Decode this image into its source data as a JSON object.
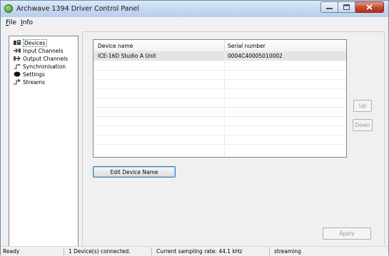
{
  "window": {
    "title": "Archwave 1394 Driver Control Panel"
  },
  "menu": [
    {
      "label": "File",
      "accel": "F",
      "rest": "ile"
    },
    {
      "label": "Info",
      "accel": "I",
      "rest": "nfo"
    }
  ],
  "tree": [
    {
      "label": "Devices",
      "icon": "devices-icon",
      "selected": true
    },
    {
      "label": "Input Channels",
      "icon": "input-channels-icon"
    },
    {
      "label": "Output Channels",
      "icon": "output-channels-icon"
    },
    {
      "label": "Synchronisation",
      "icon": "synchronisation-icon"
    },
    {
      "label": "Settings",
      "icon": "settings-icon"
    },
    {
      "label": "Streams",
      "icon": "streams-icon"
    }
  ],
  "grid": {
    "columns": [
      "Device name",
      "Serial number"
    ],
    "rows": [
      {
        "name": "ICE-16D Studio A Unit",
        "serial": "0004C40005010002"
      }
    ]
  },
  "buttons": {
    "edit_device_name": "Edit Device Name",
    "up": "Up",
    "down": "Down",
    "apply": "Apply"
  },
  "status": {
    "ready": "Ready",
    "devices": "1 Device(s) connected.",
    "sampling_rate": "Current sampling rate: 44.1 kHz",
    "streaming": "streaming"
  },
  "colors": {
    "titlebar": "#c5d8ef",
    "close_button": "#c8452e",
    "selected_row": "#e4e4e4"
  }
}
